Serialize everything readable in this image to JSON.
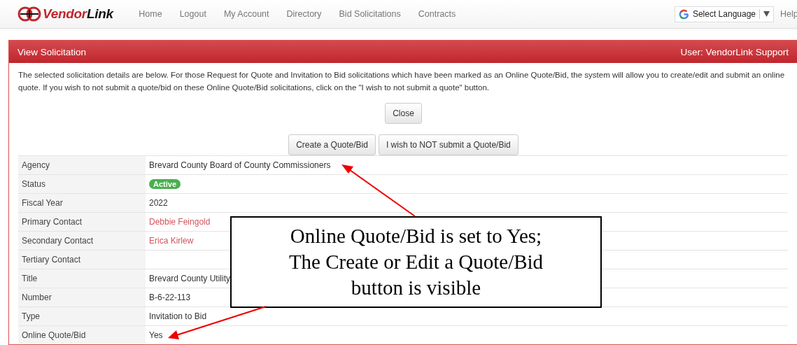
{
  "header": {
    "logo": "VendorLink",
    "nav": [
      "Home",
      "Logout",
      "My Account",
      "Directory",
      "Bid Solicitations",
      "Contracts"
    ],
    "language": "Select Language",
    "help": "Help"
  },
  "panel": {
    "title": "View Solicitation",
    "user": "User: VendorLink Support",
    "intro": "The selected solicitation details are below. For those Request for Quote and Invitation to Bid solicitations which have been marked as an Online Quote/Bid, the system will allow you to create/edit and submit an online quote. If you wish to not submit a quote/bid on these Online Quote/Bid solicitations, click on the \"I wish to not submit a quote\" button.",
    "close_button": "Close",
    "action_buttons": [
      "Create a Quote/Bid",
      "I wish to NOT submit a Quote/Bid"
    ],
    "details": [
      {
        "label": "Agency",
        "value": "Brevard County Board of County Commissioners",
        "kind": "text"
      },
      {
        "label": "Status",
        "value": "Active",
        "kind": "badge",
        "color": "#4caf50"
      },
      {
        "label": "Fiscal Year",
        "value": "2022",
        "kind": "text"
      },
      {
        "label": "Primary Contact",
        "value": "Debbie Feingold",
        "kind": "link"
      },
      {
        "label": "Secondary Contact",
        "value": "Erica Kirlew",
        "kind": "link"
      },
      {
        "label": "Tertiary Contact"
      },
      {
        "label": "Title",
        "value": "Brevard County Utility",
        "kind": "text"
      },
      {
        "label": "Number",
        "value": "B-6-22-113",
        "kind": "text"
      },
      {
        "label": "Type",
        "value": "Invitation to Bid",
        "kind": "text"
      },
      {
        "label": "Online Quote/Bid",
        "value": "Yes",
        "kind": "text"
      }
    ]
  },
  "callout": {
    "lines": [
      "Online Quote/Bid is set to Yes;",
      "The Create or Edit a Quote/Bid",
      "button is visible"
    ]
  }
}
